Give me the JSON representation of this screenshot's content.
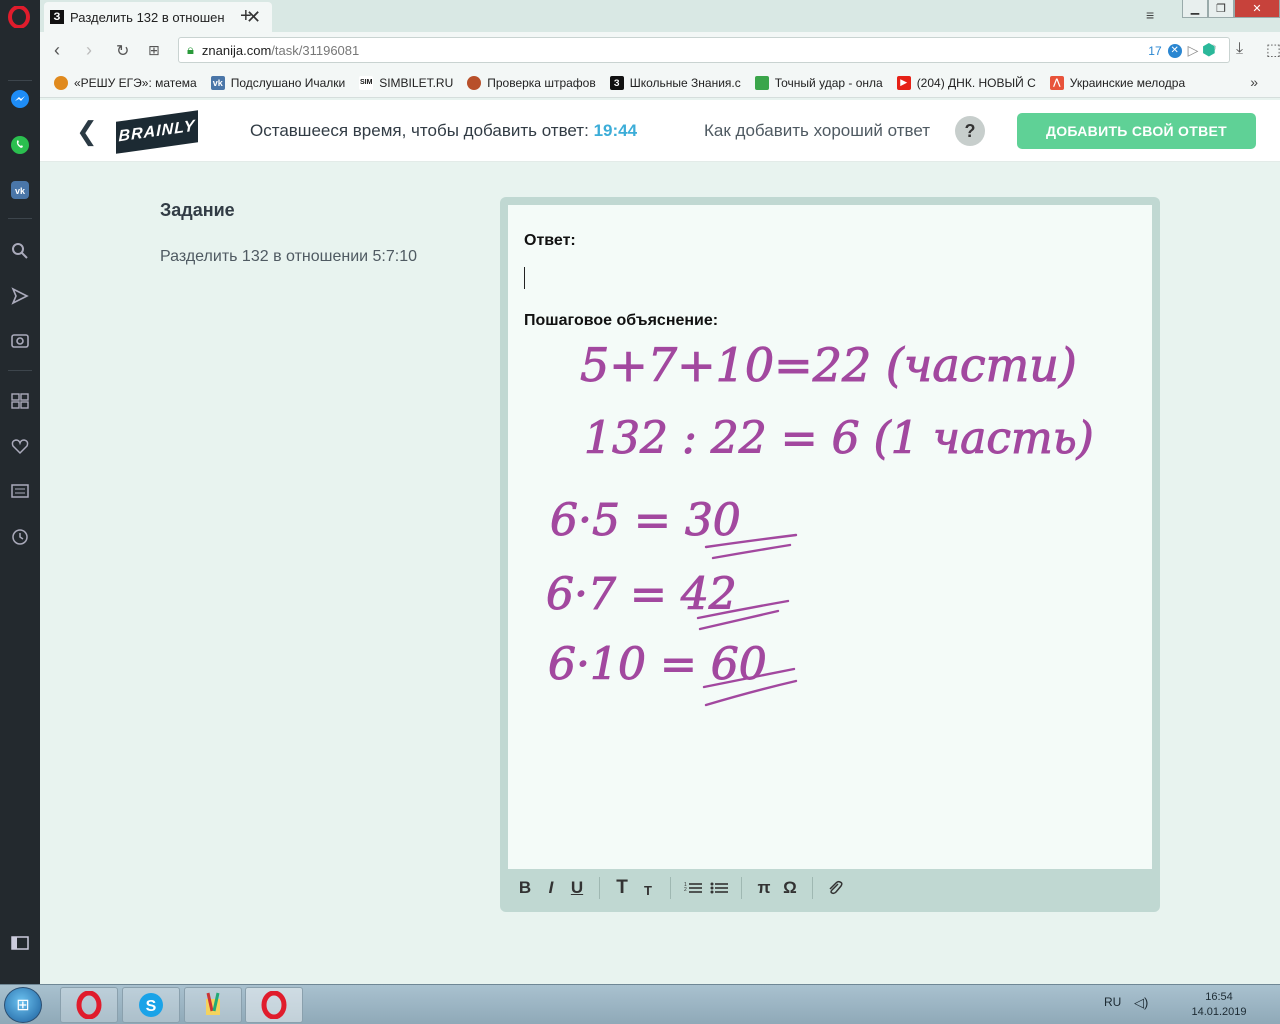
{
  "browser": {
    "tab": {
      "favicon_text": "З",
      "title": "Разделить 132 в отношен"
    },
    "url": {
      "host": "znanija.com",
      "path": "/task/31196081",
      "badge_count": "17"
    },
    "bookmarks": [
      {
        "label": "«РЕШУ ЕГЭ»: матема",
        "color": "#e08a1e",
        "icon_text": ""
      },
      {
        "label": "Подслушано Ичалки",
        "color": "#4a76a8",
        "icon_text": "vk"
      },
      {
        "label": "SIMBILET.RU",
        "color": "#ffffff",
        "icon_text": "SIM"
      },
      {
        "label": "Проверка штрафов",
        "color": "#b8502a",
        "icon_text": ""
      },
      {
        "label": "Школьные Знания.c",
        "color": "#111111",
        "icon_text": "З"
      },
      {
        "label": "Точный удар - онла",
        "color": "#3aa54a",
        "icon_text": ""
      },
      {
        "label": "(204) ДНК. НОВЫЙ С",
        "color": "#e62117",
        "icon_text": "▶"
      },
      {
        "label": "Украинские мелодра",
        "color": "#e8533a",
        "icon_text": "⋀"
      }
    ]
  },
  "header": {
    "logo": "BRAINLY",
    "time_label": "Оставшееся время, чтобы добавить ответ:",
    "time_value": "19:44",
    "how_to": "Как добавить хороший ответ",
    "help": "?",
    "add_button": "ДОБАВИТЬ СВОЙ ОТВЕТ"
  },
  "task": {
    "heading": "Задание",
    "text": "Разделить 132 в отношении 5:7:10"
  },
  "answer": {
    "answer_label": "Ответ:",
    "steps_label": "Пошаговое объяснение:",
    "handwritten_lines": [
      "5+7+10=22 (части)",
      "132 : 22 = 6 (1 часть)",
      "6·5 = 30",
      "6·7 = 42",
      "6·10 = 60"
    ],
    "ink_color": "#a2489f"
  },
  "editor_toolbar": {
    "bold": "B",
    "italic": "I",
    "underline": "U",
    "text_large": "T",
    "text_small": "T",
    "ordered_list": "☰",
    "bullet_list": "☰",
    "pi": "π",
    "omega": "Ω",
    "attach": "⌀"
  },
  "taskbar": {
    "lang": "RU",
    "time": "16:54",
    "date": "14.01.2019"
  }
}
